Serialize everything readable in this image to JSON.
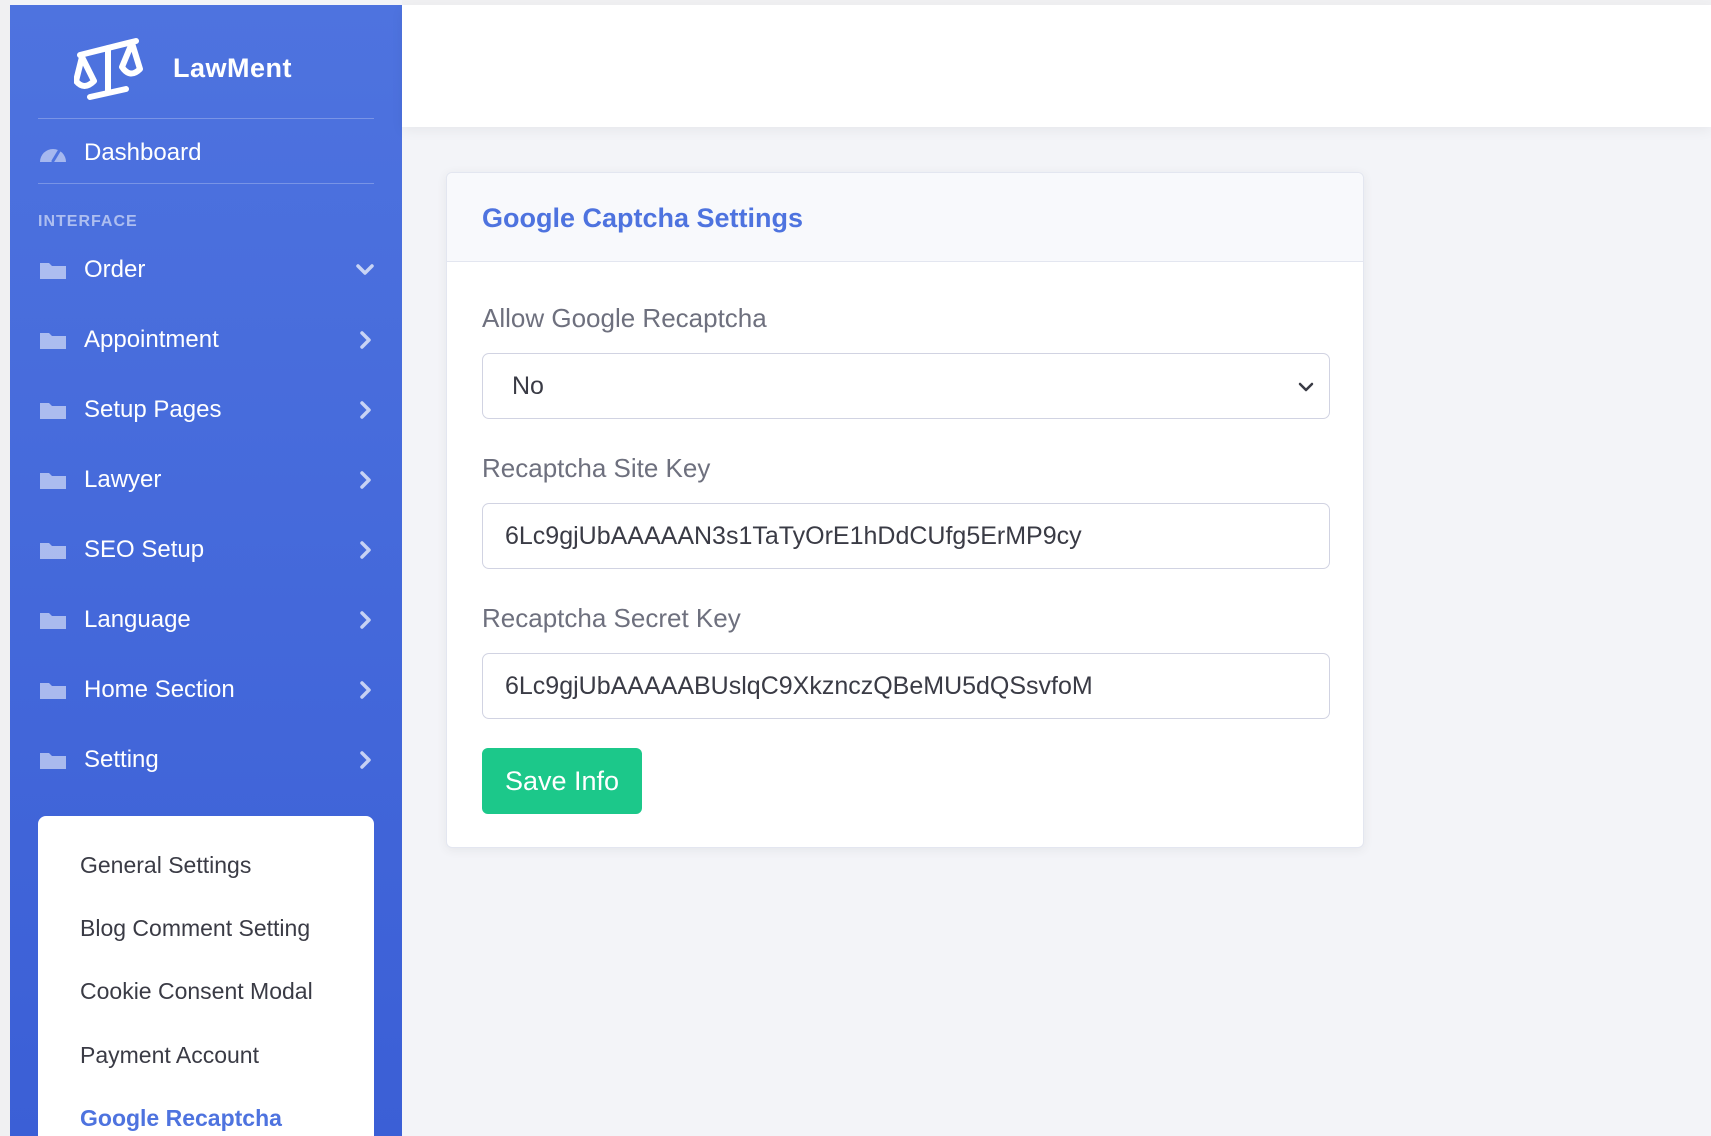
{
  "brand": {
    "name": "LawMent",
    "logo_icon": "scales-of-justice-icon"
  },
  "sidebar": {
    "dashboard": {
      "label": "Dashboard",
      "icon": "tachometer-icon"
    },
    "section_heading": "INTERFACE",
    "items": [
      {
        "label": "Order",
        "icon": "folder-icon",
        "expanded": true
      },
      {
        "label": "Appointment",
        "icon": "folder-icon",
        "expanded": false
      },
      {
        "label": "Setup Pages",
        "icon": "folder-icon",
        "expanded": false
      },
      {
        "label": "Lawyer",
        "icon": "folder-icon",
        "expanded": false
      },
      {
        "label": "SEO Setup",
        "icon": "folder-icon",
        "expanded": false
      },
      {
        "label": "Language",
        "icon": "folder-icon",
        "expanded": false
      },
      {
        "label": "Home Section",
        "icon": "folder-icon",
        "expanded": false
      },
      {
        "label": "Setting",
        "icon": "folder-icon",
        "expanded": false
      }
    ],
    "setting_submenu": [
      {
        "label": "General Settings",
        "active": false
      },
      {
        "label": "Blog Comment Setting",
        "active": false
      },
      {
        "label": "Cookie Consent Modal",
        "active": false
      },
      {
        "label": "Payment Account",
        "active": false
      },
      {
        "label": "Google Recaptcha",
        "active": true
      }
    ]
  },
  "card": {
    "title": "Google Captcha Settings",
    "allow_label": "Allow Google Recaptcha",
    "allow_value": "No",
    "site_key_label": "Recaptcha Site Key",
    "site_key_value": "6Lc9gjUbAAAAAN3s1TaTyOrE1hDdCUfg5ErMP9cy",
    "secret_key_label": "Recaptcha Secret Key",
    "secret_key_value": "6Lc9gjUbAAAAABUslqC9XkznczQBeMU5dQSsvfoM",
    "save_label": "Save Info"
  },
  "colors": {
    "sidebar": "#4e73df",
    "accent": "#4e73df",
    "save_button": "#1cc88a"
  }
}
